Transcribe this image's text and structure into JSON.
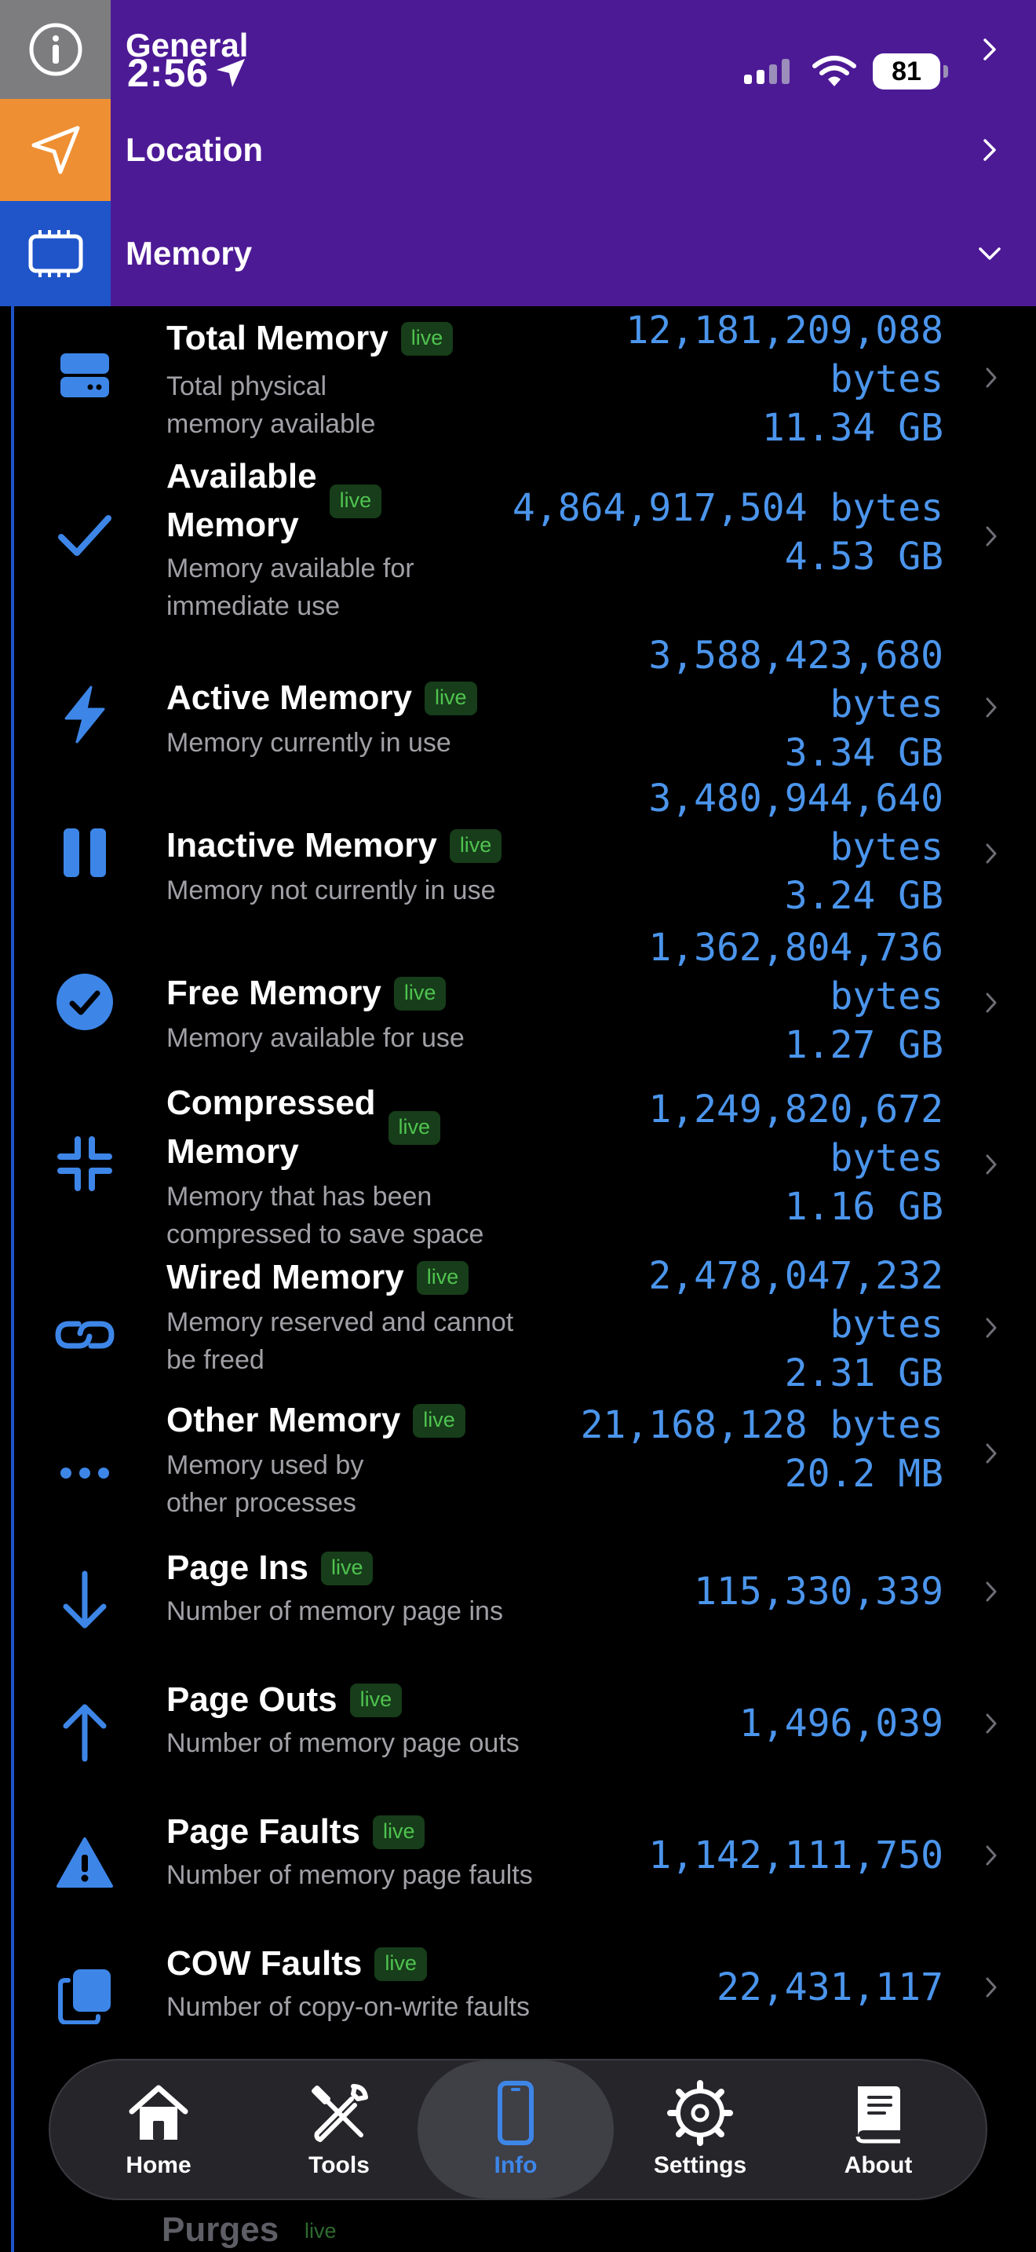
{
  "status": {
    "time": "2:56",
    "battery": "81"
  },
  "sections": [
    {
      "label": "General",
      "icon": "info-icon"
    },
    {
      "label": "Location",
      "icon": "location-arrow-icon"
    },
    {
      "label": "Memory",
      "icon": "memory-chip-icon"
    }
  ],
  "badge": "live",
  "rows": [
    {
      "title": "Total Memory",
      "sub": "Total physical\nmemory available",
      "value": "12,181,209,088\nbytes\n11.34 GB",
      "icon": "storage-icon"
    },
    {
      "title": "Available\nMemory",
      "sub": "Memory available for\nimmediate use",
      "value": "4,864,917,504 bytes\n4.53 GB",
      "icon": "checkmark-icon"
    },
    {
      "title": "Active Memory",
      "sub": "Memory currently in use",
      "value": "3,588,423,680\nbytes\n3.34 GB",
      "icon": "bolt-icon"
    },
    {
      "title": "Inactive Memory",
      "sub": "Memory not currently in use",
      "value": "3,480,944,640\nbytes\n3.24 GB",
      "icon": "pause-icon"
    },
    {
      "title": "Free Memory",
      "sub": "Memory available for use",
      "value": "1,362,804,736\nbytes\n1.27 GB",
      "icon": "check-circle-icon"
    },
    {
      "title": "Compressed\nMemory",
      "sub": "Memory that has been\ncompressed to save space",
      "value": "1,249,820,672\nbytes\n1.16 GB",
      "icon": "compress-icon"
    },
    {
      "title": "Wired Memory",
      "sub": "Memory reserved and cannot\nbe freed",
      "value": "2,478,047,232\nbytes\n2.31 GB",
      "icon": "link-icon"
    },
    {
      "title": "Other Memory",
      "sub": "Memory used by\nother processes",
      "value": "21,168,128 bytes\n20.2 MB",
      "icon": "ellipsis-icon"
    },
    {
      "title": "Page Ins",
      "sub": "Number of memory page ins",
      "value": "115,330,339",
      "icon": "arrow-down-icon"
    },
    {
      "title": "Page Outs",
      "sub": "Number of memory page outs",
      "value": "1,496,039",
      "icon": "arrow-up-icon"
    },
    {
      "title": "Page Faults",
      "sub": "Number of memory page faults",
      "value": "1,142,111,750",
      "icon": "warning-icon"
    },
    {
      "title": "COW Faults",
      "sub": "Number of copy-on-write faults",
      "value": "22,431,117",
      "icon": "copy-icon"
    }
  ],
  "peek": {
    "title": "Purges"
  },
  "tabs": [
    {
      "label": "Home",
      "icon": "home-icon"
    },
    {
      "label": "Tools",
      "icon": "tools-icon"
    },
    {
      "label": "Info",
      "icon": "phone-icon"
    },
    {
      "label": "Settings",
      "icon": "gear-icon"
    },
    {
      "label": "About",
      "icon": "book-icon"
    }
  ],
  "colors": {
    "header": "#4d1a96",
    "accent": "#4b95ec",
    "live_bg": "#173d1a",
    "live_text": "#4fc34f"
  }
}
